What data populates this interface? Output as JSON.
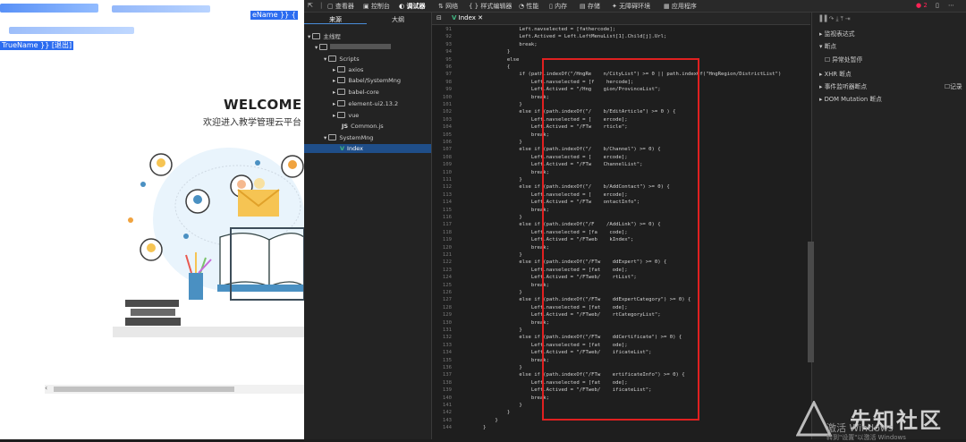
{
  "webpage": {
    "header_suffix": "eName }} {",
    "username_link": "TrueName }} [退出]",
    "welcome": "WELCOME",
    "subtitle": "欢迎进入教学管理云平台"
  },
  "devtools": {
    "tabs": [
      "查看器",
      "控制台",
      "调试器",
      "网络",
      "样式编辑器",
      "性能",
      "内存",
      "存储",
      "无障碍环境",
      "应用程序"
    ],
    "active_tab": "调试器",
    "badge": "2",
    "source_tabs": [
      "来源",
      "大纲"
    ],
    "tree": [
      {
        "label": "主线程",
        "depth": 0
      },
      {
        "label": "",
        "depth": 1
      },
      {
        "label": "Scripts",
        "depth": 2
      },
      {
        "label": "axios",
        "depth": 3
      },
      {
        "label": "Babel/SystemMng",
        "depth": 3
      },
      {
        "label": "babel-core",
        "depth": 3
      },
      {
        "label": "element-ui2.13.2",
        "depth": 3
      },
      {
        "label": "vue",
        "depth": 3
      },
      {
        "label": "Common.js",
        "depth": 4
      },
      {
        "label": "SystemMng",
        "depth": 2
      },
      {
        "label": "Index",
        "depth": 4
      }
    ],
    "editor_tab": "Index",
    "right_panel": [
      "监视表达式",
      "断点",
      "异常处暂停",
      "XHR 断点",
      "事件监听器断点",
      "记录",
      "DOM Mutation 断点"
    ]
  },
  "code_lines": [
    {
      "n": "91",
      "t": "                    Left.navselected = [fathercode];"
    },
    {
      "n": "92",
      "t": "                    Left.Actived = Left.LeftMenuList[1].Child[j].Url;"
    },
    {
      "n": "93",
      "t": "                    break;"
    },
    {
      "n": "94",
      "t": "                }"
    },
    {
      "n": "95",
      "t": "                else"
    },
    {
      "n": "96",
      "t": "                {"
    },
    {
      "n": "97",
      "t": "                    if (path.indexOf(\"/HngRe    n/CityList\") >= 0 || path.indexOf(\"HngRegion/DistrictList\")"
    },
    {
      "n": "98",
      "t": "                        Left.navselected = [f    hercode];"
    },
    {
      "n": "99",
      "t": "                        Left.Actived = \"/Hng    gion/ProvinceList\";"
    },
    {
      "n": "100",
      "t": "                        break;"
    },
    {
      "n": "101",
      "t": "                    }"
    },
    {
      "n": "102",
      "t": "                    else if (path.indexOf(\"/    b/EditArticle\") >= 0 ) {"
    },
    {
      "n": "103",
      "t": "                        Left.navselected = [    ercode];"
    },
    {
      "n": "104",
      "t": "                        Left.Actived = \"/FTw    rticle\";"
    },
    {
      "n": "105",
      "t": "                        break;"
    },
    {
      "n": "106",
      "t": "                    }"
    },
    {
      "n": "107",
      "t": "                    else if (path.indexOf(\"/    b/Channel\") >= 0) {"
    },
    {
      "n": "108",
      "t": "                        Left.navselected = [    ercode];"
    },
    {
      "n": "109",
      "t": "                        Left.Actived = \"/FTw    ChannelList\";"
    },
    {
      "n": "110",
      "t": "                        break;"
    },
    {
      "n": "111",
      "t": "                    }"
    },
    {
      "n": "112",
      "t": "                    else if (path.indexOf(\"/    b/AddContact\") >= 0) {"
    },
    {
      "n": "113",
      "t": "                        Left.navselected = [    ercode];"
    },
    {
      "n": "114",
      "t": "                        Left.Actived = \"/FTw    ontactInfo\";"
    },
    {
      "n": "115",
      "t": "                        break;"
    },
    {
      "n": "116",
      "t": "                    }"
    },
    {
      "n": "117",
      "t": "                    else if (path.indexOf(\"/F    /AddLink\") >= 0) {"
    },
    {
      "n": "118",
      "t": "                        Left.navselected = [fa    code];"
    },
    {
      "n": "119",
      "t": "                        Left.Actived = \"/FTweb    kIndex\";"
    },
    {
      "n": "120",
      "t": "                        break;"
    },
    {
      "n": "121",
      "t": "                    }"
    },
    {
      "n": "122",
      "t": "                    else if (path.indexOf(\"/FTw    ddExpert\") >= 0) {"
    },
    {
      "n": "123",
      "t": "                        Left.navselected = [fat    ode];"
    },
    {
      "n": "124",
      "t": "                        Left.Actived = \"/FTweb/    rtList\";"
    },
    {
      "n": "125",
      "t": "                        break;"
    },
    {
      "n": "126",
      "t": "                    }"
    },
    {
      "n": "127",
      "t": "                    else if (path.indexOf(\"/FTw    ddExpertCategory\") >= 0) {"
    },
    {
      "n": "128",
      "t": "                        Left.navselected = [fat    ode];"
    },
    {
      "n": "129",
      "t": "                        Left.Actived = \"/FTweb/    rtCategoryList\";"
    },
    {
      "n": "130",
      "t": "                        break;"
    },
    {
      "n": "131",
      "t": "                    }"
    },
    {
      "n": "132",
      "t": "                    else if (path.indexOf(\"/FTw    ddCertificate\") >= 0) {"
    },
    {
      "n": "133",
      "t": "                        Left.navselected = [fat    ode];"
    },
    {
      "n": "134",
      "t": "                        Left.Actived = \"/FTweb/    ificateList\";"
    },
    {
      "n": "135",
      "t": "                        break;"
    },
    {
      "n": "136",
      "t": "                    }"
    },
    {
      "n": "137",
      "t": "                    else if (path.indexOf(\"/FTw    ertificateInfo\") >= 0) {"
    },
    {
      "n": "138",
      "t": "                        Left.navselected = [fat    ode];"
    },
    {
      "n": "139",
      "t": "                        Left.Actived = \"/FTweb/    ificateList\";"
    },
    {
      "n": "140",
      "t": "                        break;"
    },
    {
      "n": "141",
      "t": "                    }"
    },
    {
      "n": "142",
      "t": "                }"
    },
    {
      "n": "143",
      "t": "            }"
    },
    {
      "n": "144",
      "t": "        }"
    }
  ],
  "watermark": {
    "site": "先知社区",
    "activate": "激活 Windows",
    "hint": "转到\"设置\"以激活 Windows"
  }
}
